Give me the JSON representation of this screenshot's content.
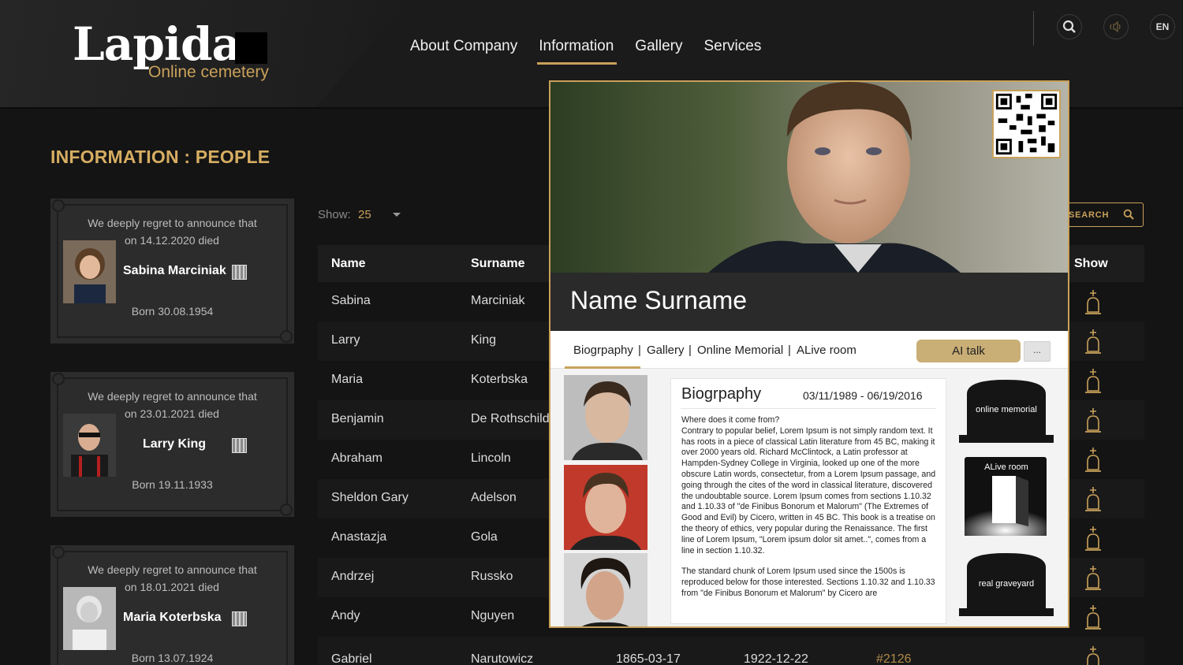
{
  "header": {
    "logo_main": "Lapida",
    "logo_sub": "Online cemetery",
    "nav": [
      "About Company",
      "Information",
      "Gallery",
      "Services"
    ],
    "active_nav": "Information",
    "lang": "EN"
  },
  "page_title": "INFORMATION : PEOPLE",
  "cards": [
    {
      "regret": "We deeply regret to announce that",
      "died": "on 14.12.2020 died",
      "name": "Sabina Marciniak",
      "born": "Born 30.08.1954"
    },
    {
      "regret": "We deeply regret to announce that",
      "died": "on 23.01.2021 died",
      "name": "Larry King",
      "born": "Born 19.11.1933"
    },
    {
      "regret": "We deeply regret to announce that",
      "died": "on 18.01.2021 died",
      "name": "Maria Koterbska",
      "born": "Born 13.07.1924"
    }
  ],
  "table": {
    "show_label": "Show:",
    "show_value": "25",
    "search_label": "SEARCH",
    "headers": {
      "name": "Name",
      "surname": "Surname",
      "show": "Show"
    },
    "rows": [
      {
        "name": "Sabina",
        "surname": "Marciniak"
      },
      {
        "name": "Larry",
        "surname": "King"
      },
      {
        "name": "Maria",
        "surname": "Koterbska"
      },
      {
        "name": "Benjamin",
        "surname": "De Rothschild"
      },
      {
        "name": "Abraham",
        "surname": "Lincoln"
      },
      {
        "name": "Sheldon Gary",
        "surname": "Adelson"
      },
      {
        "name": "Anastazja",
        "surname": "Gola"
      },
      {
        "name": "Andrzej",
        "surname": "Russko"
      },
      {
        "name": "Andy",
        "surname": "Nguyen"
      },
      {
        "name": "Gabriel",
        "surname": "Narutowicz",
        "born": "1865-03-17",
        "died": "1922-12-22",
        "number": "#2126"
      }
    ]
  },
  "modal": {
    "name": "Name Surname",
    "tabs": [
      "Biogrpaphy",
      "Gallery",
      "Online Memorial",
      "ALive room"
    ],
    "ai_button": "AI talk",
    "more_button": "...",
    "bio_title": "Biogrpaphy",
    "bio_dates": "03/11/1989 - 06/19/2016",
    "bio_p1": "Where does it come from?\nContrary to popular belief, Lorem Ipsum is not simply random text. It has roots in a piece of classical Latin literature from 45 BC, making it over 2000 years old. Richard McClintock, a Latin professor at Hampden-Sydney College in Virginia, looked up one of the more obscure Latin words, consectetur, from a Lorem Ipsum passage, and going through the cites of the word in classical literature, discovered the undoubtable source. Lorem Ipsum comes from sections 1.10.32 and 1.10.33 of \"de Finibus Bonorum et Malorum\" (The Extremes of Good and Evil) by Cicero, written in 45 BC. This book is a treatise on the theory of ethics, very popular during the Renaissance. The first line of Lorem Ipsum, \"Lorem ipsum dolor sit amet..\", comes from a line in section 1.10.32.",
    "bio_p2": "The standard chunk of Lorem Ipsum used since the 1500s is reproduced below for those interested. Sections 1.10.32 and 1.10.33 from \"de Finibus Bonorum et Malorum\" by Cicero are",
    "tiles": [
      "online memorial",
      "ALive room",
      "real graveyard"
    ]
  },
  "colors": {
    "accent": "#c9a15a",
    "background": "#141414",
    "modal_bg": "#f3f3f3"
  }
}
